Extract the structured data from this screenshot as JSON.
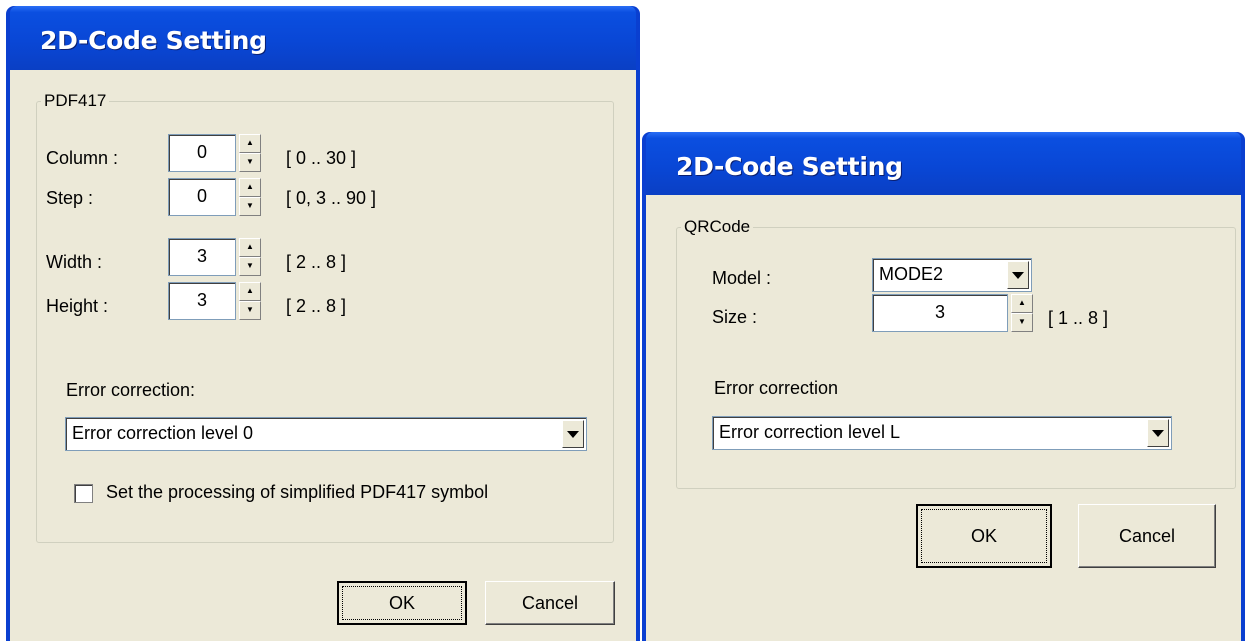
{
  "pdf417_dialog": {
    "title": "2D-Code Setting",
    "group_label": "PDF417",
    "fields": [
      {
        "label": "Column :",
        "value": "0",
        "range": "[ 0 .. 30 ]"
      },
      {
        "label": "Step :",
        "value": "0",
        "range": "[ 0, 3 .. 90 ]"
      },
      {
        "label": "Width :",
        "value": "3",
        "range": "[ 2 .. 8 ]"
      },
      {
        "label": "Height :",
        "value": "3",
        "range": "[ 2 .. 8 ]"
      }
    ],
    "error_label": "Error correction:",
    "error_value": "Error correction level 0",
    "checkbox_label": "Set the processing of simplified PDF417 symbol",
    "ok_label": "OK",
    "cancel_label": "Cancel"
  },
  "qrcode_dialog": {
    "title": "2D-Code Setting",
    "group_label": "QRCode",
    "model_label": "Model :",
    "model_value": "MODE2",
    "size_label": "Size :",
    "size_value": "3",
    "size_range": "[ 1 .. 8 ]",
    "error_label": "Error correction",
    "error_value": "Error correction level L",
    "ok_label": "OK",
    "cancel_label": "Cancel"
  }
}
